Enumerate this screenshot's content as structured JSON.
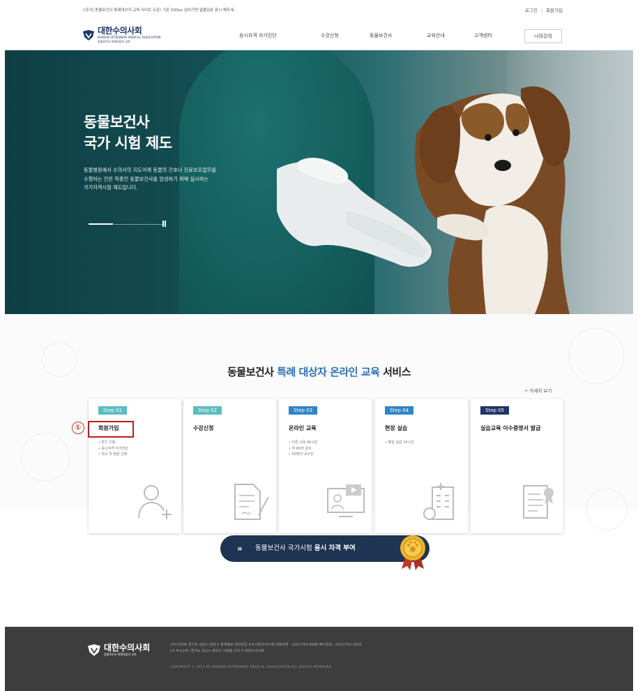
{
  "topbar": {
    "notice": "[공지] 동물보건사 특례대상자 교육 사이트 오픈! 기존 500px 넘어가면 말줄임표 표시 해주세..",
    "login": "로그인",
    "separator": "|",
    "signup": "회원가입"
  },
  "header": {
    "logo_main": "대한수의사회",
    "logo_sub_top": "KOREAN VETERINARY MEDICAL ASSOCIATION",
    "logo_sub": "동물보건사 특례대상자 교육",
    "nav": [
      "응시자격 자가진단",
      "수강신청",
      "동물보건사",
      "교육안내",
      "고객센터"
    ],
    "my_course": "나의강의",
    "brand_color": "#1f3566"
  },
  "hero": {
    "title_line1": "동물보건사",
    "title_line2": "국가 시험 제도",
    "desc_line1": "동물병원에서 수의사의 지도아래 동물의 간호나 진료보조업무를",
    "desc_line2": "수행하는 전문 직종인 동물보건사를 양성하기 위해 실시하는",
    "desc_line3": "국가자격시험 제도입니다.",
    "slider_progress": 0.33
  },
  "service": {
    "title_a": "동물보건사 ",
    "title_b": "특례 대상자 온라인 교육",
    "title_c": " 서비스",
    "more": "+ 자세히 보기",
    "marker": "①",
    "steps": [
      {
        "step": "Step 01",
        "name": "회원가입",
        "items": [
          "• 본인 인증",
          "• 응시자격 자가진단",
          "• 학교 및 병원 선택"
        ],
        "color": "#5bbcc4",
        "icon": "user-add-icon"
      },
      {
        "step": "Step 02",
        "name": "수강신청",
        "items": [],
        "color": "#5bbcc4",
        "icon": "document-sign-icon"
      },
      {
        "step": "Step 03",
        "name": "온라인 교육",
        "items": [
          "• 이론 교육 96시간",
          "• 약 80개 강의",
          "• 50명의 교수진"
        ],
        "color": "#2f85c6",
        "icon": "online-lecture-icon"
      },
      {
        "step": "Step 04",
        "name": "현장 실습",
        "items": [
          "• 병원 실습 24시간"
        ],
        "color": "#2f85c6",
        "icon": "hospital-icon"
      },
      {
        "step": "Step 05",
        "name": "실습교육 이수증명서 발급",
        "items": [],
        "color": "#1f3566",
        "icon": "certificate-icon"
      }
    ]
  },
  "qualification": {
    "chevron": "»",
    "text_normal": "동물보건사 국가시험 ",
    "text_bold": "응시 자격 부여"
  },
  "footer": {
    "logo_main": "대한수의사회",
    "logo_sub": "동물보건사 특례대상자 교육",
    "address_line1": "(우)13590 경기도 성남시 분당구 황새울로 353번길 9-6 대한수의사회 대표전화 : (031)702-8686 팩스번호 : (031)702-2020",
    "address_line2": "(구 주소)(주) 경기도 성남시 분당구 서현동 272-5 대한수의사회",
    "copyright": "COPYRIGHT © 2017 BY KOREAN VETERINARY MEDICAL ASSOCIATION ALL RIGHTS RESERVED"
  }
}
